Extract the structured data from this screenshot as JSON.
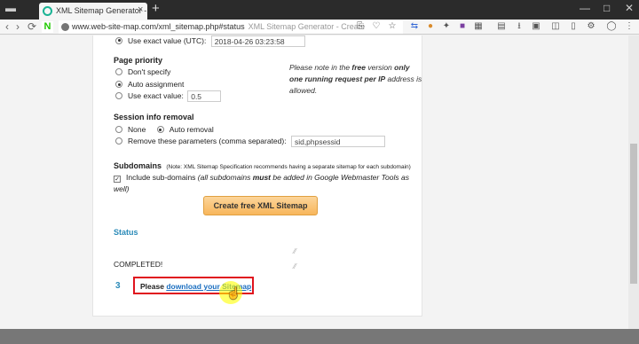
{
  "browser": {
    "tab_title": "XML Sitemap Generator -",
    "tab_close": "×",
    "new_tab": "+",
    "url": "www.web-site-map.com/xml_sitemap.php#status",
    "url_page_title": "XML Sitemap Generator - Create",
    "nav_back": "‹",
    "nav_forward": "›",
    "nav_reload": "⟳",
    "logo_letter": "N",
    "window_min": "—",
    "window_max": "□",
    "window_close": "✕"
  },
  "form": {
    "lastmod_exact_label": "Use exact value (UTC):",
    "lastmod_exact_value": "2018-04-26 03:23:58",
    "page_priority": {
      "heading": "Page priority",
      "dont_specify": "Don't specify",
      "auto": "Auto assignment",
      "exact_label": "Use exact value:",
      "exact_value": "0.5"
    },
    "note": {
      "part1": "Please note in the ",
      "free": "free",
      "part2": " version ",
      "bold": "only one running request per IP",
      "part3": " address is allowed."
    },
    "session": {
      "heading": "Session info removal",
      "none": "None",
      "auto": "Auto removal",
      "remove_label": "Remove these parameters (comma separated):",
      "remove_value": "sid,phpsessid"
    },
    "subdomains": {
      "heading": "Subdomains",
      "heading_note": "(Note: XML Sitemap Specification recommends having a separate sitemap for each subdomain)",
      "include_label": "Include sub-domains",
      "include_note_a": " (all subdomains ",
      "include_note_must": "must",
      "include_note_b": " be added in Google Webmaster Tools as",
      "include_note_c": "well)",
      "checked": true
    },
    "submit_label": "Create free XML Sitemap"
  },
  "status": {
    "heading": "Status",
    "completed": "COMPLETED!",
    "step_number": "3",
    "step_prefix": "Please ",
    "step_link": "download your Sitemap"
  },
  "colors": {
    "accent": "#2a8ab8",
    "cta": "#f8b65b",
    "highlight_box": "#e0141e"
  }
}
